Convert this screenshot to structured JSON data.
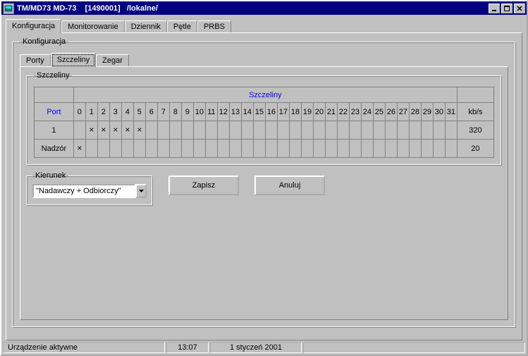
{
  "window": {
    "title": "TM/MD73 MD-73    [1490001]   /lokalne/"
  },
  "tabs_main": [
    "Konfiguracja",
    "Monitorowanie",
    "Dziennik",
    "Pętle",
    "PRBS"
  ],
  "tabs_main_active": 0,
  "group_konf_label": "Konfiguracja",
  "tabs_inner": [
    "Porty",
    "Szczeliny",
    "Zegar"
  ],
  "tabs_inner_active": 1,
  "group_szc_label": "Szczeliny",
  "table": {
    "header_main": "Szczeliny",
    "header_port": "Port",
    "header_kbs": "kb/s",
    "slot_numbers": [
      "0",
      "1",
      "2",
      "3",
      "4",
      "5",
      "6",
      "7",
      "8",
      "9",
      "10",
      "11",
      "12",
      "13",
      "14",
      "15",
      "16",
      "17",
      "18",
      "19",
      "20",
      "21",
      "22",
      "23",
      "24",
      "25",
      "26",
      "27",
      "28",
      "29",
      "30",
      "31"
    ],
    "rows": [
      {
        "label": "1",
        "marks": [
          1,
          2,
          3,
          4,
          5
        ],
        "kbs": "320"
      },
      {
        "label": "Nadzór",
        "marks": [
          0
        ],
        "kbs": "20"
      }
    ]
  },
  "kierunek": {
    "legend": "Kierunek",
    "value": "\"Nadawczy + Odbiorczy\""
  },
  "buttons": {
    "save": "Zapisz",
    "cancel": "Anuluj"
  },
  "statusbar": {
    "status": "Urządzenie aktywne",
    "time": "13:07",
    "date": "1 styczeń 2001"
  }
}
